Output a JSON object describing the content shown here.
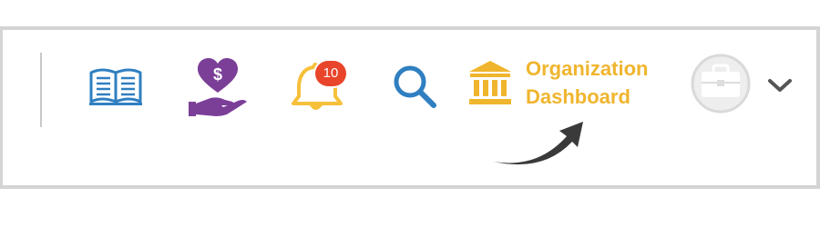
{
  "toolbar": {
    "icons": {
      "resources": "open-book-icon",
      "donate": "heart-hand-donate-icon",
      "notifications": "bell-icon",
      "search": "search-icon",
      "organization": "bank-building-icon",
      "avatar": "briefcase-avatar-icon",
      "menu": "chevron-down-icon"
    },
    "notification_count": "10",
    "organization_dashboard_label": "Organization\nDashboard"
  },
  "annotation": {
    "pointer": "curved-arrow-icon"
  },
  "colors": {
    "book_blue": "#2f7fc1",
    "donate_purple": "#7b3f98",
    "bell_gold": "#f6c03a",
    "badge_red": "#e8452a",
    "search_blue": "#2f7fc1",
    "org_gold": "#f0b52e",
    "avatar_grey": "#d9d9d9",
    "chevron_grey": "#555555",
    "arrow_dark": "#3a3a3a",
    "frame_border": "#d4d4d4"
  }
}
